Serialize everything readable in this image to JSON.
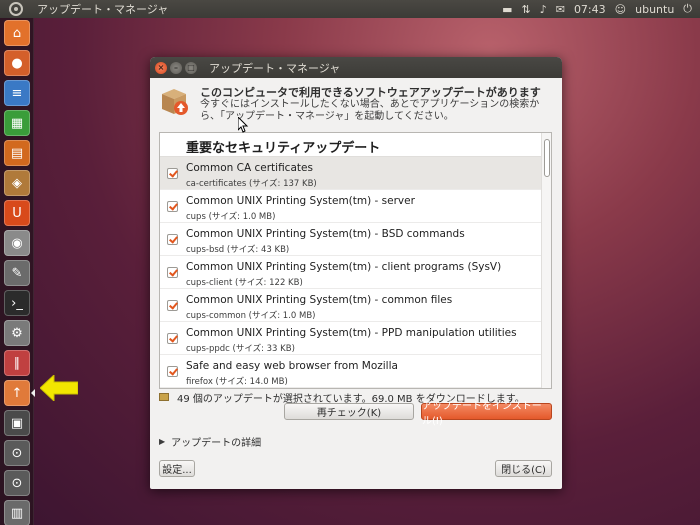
{
  "top_panel": {
    "active_window_title": "アップデート・マネージャ",
    "clock": "07:43",
    "user": "ubuntu"
  },
  "launcher": {
    "items": [
      {
        "name": "home-folder",
        "icon": "home-icon",
        "color": "#e2712b"
      },
      {
        "name": "firefox",
        "icon": "firefox-icon",
        "color": "#d45f2a"
      },
      {
        "name": "writer",
        "icon": "document-icon",
        "color": "#3a79c5"
      },
      {
        "name": "calc",
        "icon": "spreadsheet-icon",
        "color": "#3a9d3a"
      },
      {
        "name": "impress",
        "icon": "presentation-icon",
        "color": "#d2691e"
      },
      {
        "name": "software-center",
        "icon": "box-icon",
        "color": "#b07a3a"
      },
      {
        "name": "ubuntu-one",
        "icon": "u-icon",
        "color": "#d84a1b"
      },
      {
        "name": "screenshot",
        "icon": "camera-icon",
        "color": "#8a8a8a"
      },
      {
        "name": "text-editor",
        "icon": "pencil-icon",
        "color": "#6b6b6b"
      },
      {
        "name": "terminal",
        "icon": "terminal-icon",
        "color": "#2b2b2b"
      },
      {
        "name": "system-settings",
        "icon": "tools-icon",
        "color": "#7a7a7a"
      },
      {
        "name": "workspaces",
        "icon": "pencils-icon",
        "color": "#c04040"
      },
      {
        "name": "update-manager",
        "icon": "update-icon",
        "color": "#e07a3a"
      },
      {
        "name": "workspace-switcher",
        "icon": "workspace-icon",
        "color": "#4a4a4a"
      },
      {
        "name": "lens-apps",
        "icon": "magnifier-icon",
        "color": "#5a5a5a"
      },
      {
        "name": "lens-files",
        "icon": "magnifier-icon",
        "color": "#5a5a5a"
      },
      {
        "name": "trash",
        "icon": "trash-icon",
        "color": "#6a6a6a"
      }
    ]
  },
  "dialog": {
    "title": "アップデート・マネージャ",
    "headline": "このコンピュータで利用できるソフトウェアアップデートがあります",
    "subtext": "今すぐにはインストールしたくない場合、あとでアプリケーションの検索から、「アップデート・マネージャ」を起動してください。",
    "list_header": "重要なセキュリティアップデート",
    "updates": [
      {
        "name": "Common CA certificates",
        "pkg": "ca-certificates (サイズ: 137 KB)",
        "checked": true
      },
      {
        "name": "Common UNIX Printing System(tm) - server",
        "pkg": "cups (サイズ: 1.0 MB)",
        "checked": true
      },
      {
        "name": "Common UNIX Printing System(tm) - BSD commands",
        "pkg": "cups-bsd (サイズ: 43 KB)",
        "checked": true
      },
      {
        "name": "Common UNIX Printing System(tm) - client programs (SysV)",
        "pkg": "cups-client (サイズ: 122 KB)",
        "checked": true
      },
      {
        "name": "Common UNIX Printing System(tm) - common files",
        "pkg": "cups-common (サイズ: 1.0 MB)",
        "checked": true
      },
      {
        "name": "Common UNIX Printing System(tm) - PPD manipulation utilities",
        "pkg": "cups-ppdc (サイズ: 33 KB)",
        "checked": true
      },
      {
        "name": "Safe and easy web browser from Mozilla",
        "pkg": "firefox (サイズ: 14.0 MB)",
        "checked": true
      }
    ],
    "status": "49 個のアップデートが選択されています。69.0 MB をダウンロードします。",
    "recheck_label": "再チェック(K)",
    "install_label": "アップデートをインストール(I)",
    "details_label": "アップデートの詳細",
    "settings_label": "設定...",
    "close_label": "閉じる(C)"
  }
}
